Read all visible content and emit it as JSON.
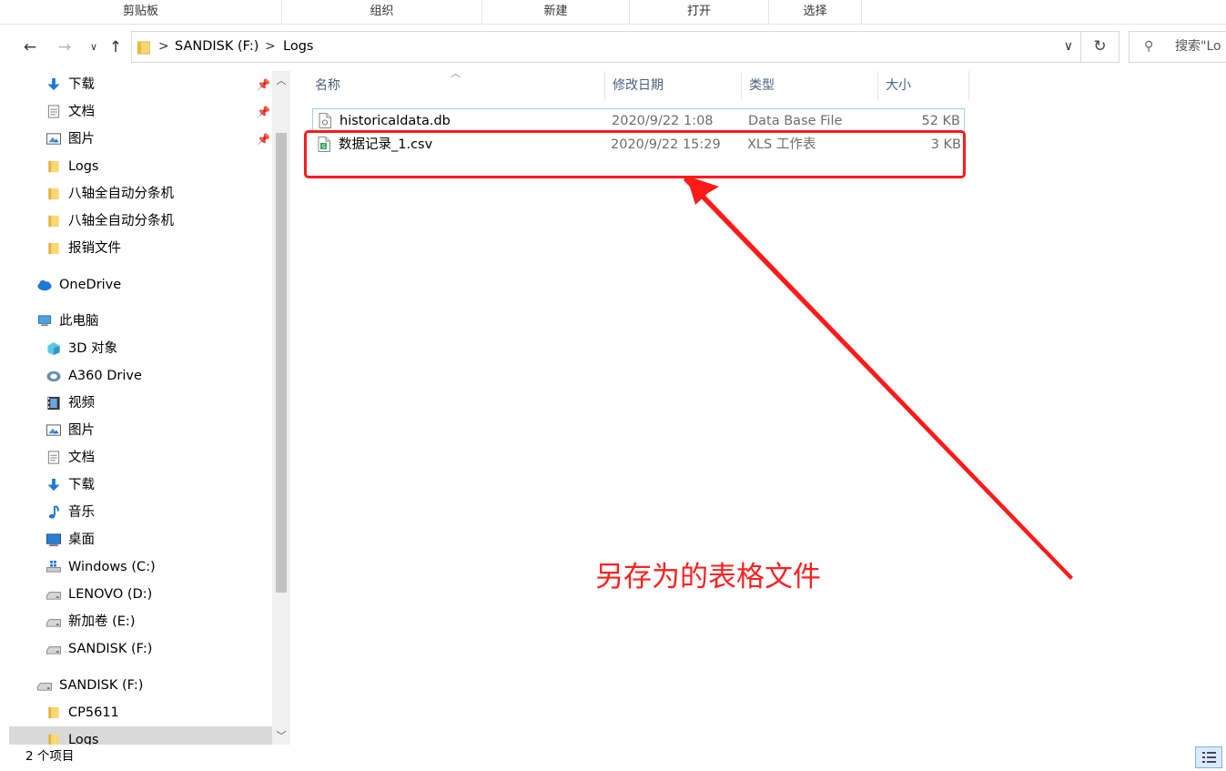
{
  "ribbon": {
    "groups": [
      "剪贴板",
      "组织",
      "新建",
      "打开",
      "选择"
    ]
  },
  "nav": {
    "back_icon": "arrow-left-icon",
    "forward_icon": "arrow-right-icon",
    "recent_icon": "chevron-down-icon",
    "up_icon": "arrow-up-icon",
    "address": [
      "SANDISK (F:)",
      "Logs"
    ],
    "search_placeholder": "搜索\"Lo"
  },
  "sidebar": {
    "items": [
      {
        "label": "下载",
        "icon": "download-arrow-icon",
        "pinned": true
      },
      {
        "label": "文档",
        "icon": "document-icon",
        "pinned": true
      },
      {
        "label": "图片",
        "icon": "pictures-icon",
        "pinned": true
      },
      {
        "label": "Logs",
        "icon": "folder-icon"
      },
      {
        "label": "八轴全自动分条机",
        "icon": "folder-icon"
      },
      {
        "label": "八轴全自动分条机",
        "icon": "folder-icon"
      },
      {
        "label": "报销文件",
        "icon": "folder-icon"
      },
      {
        "label": "OneDrive",
        "icon": "cloud-icon"
      },
      {
        "label": "此电脑",
        "icon": "computer-icon"
      },
      {
        "label": "3D 对象",
        "icon": "cube-3d-icon"
      },
      {
        "label": "A360 Drive",
        "icon": "a360-drive-icon"
      },
      {
        "label": "视频",
        "icon": "film-icon"
      },
      {
        "label": "图片",
        "icon": "pictures-icon"
      },
      {
        "label": "文档",
        "icon": "document-icon"
      },
      {
        "label": "下载",
        "icon": "download-arrow-icon"
      },
      {
        "label": "音乐",
        "icon": "music-note-icon"
      },
      {
        "label": "桌面",
        "icon": "desktop-icon"
      },
      {
        "label": "Windows (C:)",
        "icon": "windows-drive-icon"
      },
      {
        "label": "LENOVO (D:)",
        "icon": "drive-icon"
      },
      {
        "label": "新加卷 (E:)",
        "icon": "drive-icon"
      },
      {
        "label": "SANDISK (F:)",
        "icon": "drive-icon"
      },
      {
        "label": "SANDISK (F:)",
        "icon": "drive-icon"
      },
      {
        "label": "CP5611",
        "icon": "folder-icon"
      },
      {
        "label": "Logs",
        "icon": "folder-icon"
      }
    ]
  },
  "columns": [
    "名称",
    "修改日期",
    "类型",
    "大小"
  ],
  "files": [
    {
      "name": "historicaldata.db",
      "modified": "2020/9/22 1:08",
      "type": "Data Base File",
      "size": "52 KB",
      "icon": "db-file-icon"
    },
    {
      "name": "数据记录_1.csv",
      "modified": "2020/9/22 15:29",
      "type": "XLS 工作表",
      "size": "3 KB",
      "icon": "spreadsheet-file-icon"
    }
  ],
  "annotation": {
    "text": "另存为的表格文件",
    "color": "#ff2020"
  },
  "status": {
    "count": "2 个项目"
  }
}
